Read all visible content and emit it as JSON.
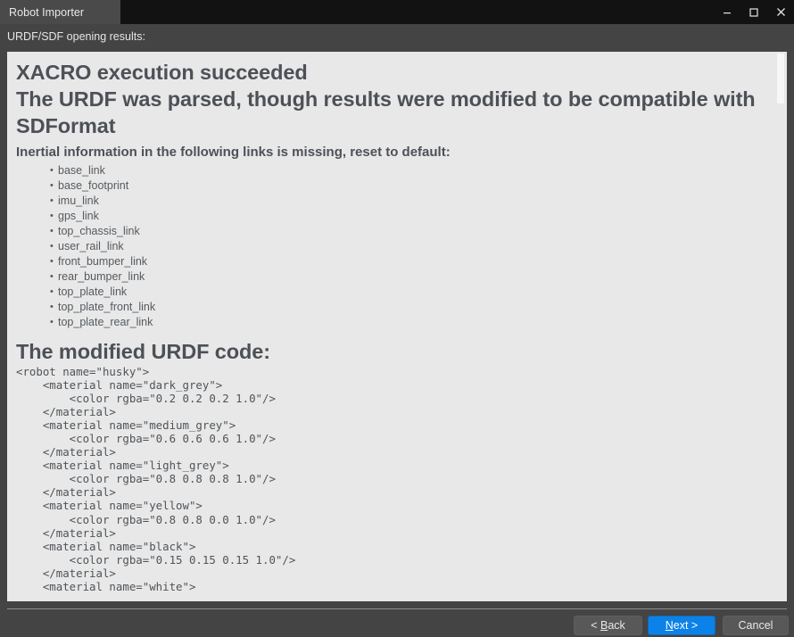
{
  "window": {
    "tab_title": "Robot Importer",
    "controls": {
      "minimize": "minimize-icon",
      "maximize": "maximize-icon",
      "close": "close-icon"
    }
  },
  "subtitle": "URDF/SDF opening results:",
  "results": {
    "heading_line_1": "XACRO execution succeeded",
    "heading_line_2": "The URDF was parsed, though results were modified to be compatible with SDFormat",
    "subheading": "Inertial information in the following links is missing, reset to default:",
    "missing_inertia_links": [
      "base_link",
      "base_footprint",
      "imu_link",
      "gps_link",
      "top_chassis_link",
      "user_rail_link",
      "front_bumper_link",
      "rear_bumper_link",
      "top_plate_link",
      "top_plate_front_link",
      "top_plate_rear_link"
    ],
    "code_heading": "The modified URDF code:",
    "code": "<robot name=\"husky\">\n    <material name=\"dark_grey\">\n        <color rgba=\"0.2 0.2 0.2 1.0\"/>\n    </material>\n    <material name=\"medium_grey\">\n        <color rgba=\"0.6 0.6 0.6 1.0\"/>\n    </material>\n    <material name=\"light_grey\">\n        <color rgba=\"0.8 0.8 0.8 1.0\"/>\n    </material>\n    <material name=\"yellow\">\n        <color rgba=\"0.8 0.8 0.0 1.0\"/>\n    </material>\n    <material name=\"black\">\n        <color rgba=\"0.15 0.15 0.15 1.0\"/>\n    </material>\n    <material name=\"white\">"
  },
  "footer": {
    "back_prefix": "< ",
    "back_accel": "B",
    "back_suffix": "ack",
    "next_accel": "N",
    "next_suffix": "ext >",
    "cancel_label": "Cancel"
  },
  "colors": {
    "titlebar_bg": "#121212",
    "tab_bg": "#4a4a4a",
    "window_bg": "#444444",
    "panel_bg": "#e8e8e8",
    "heading_text": "#4d5157",
    "body_text": "#555a5f",
    "code_text": "#4f5459",
    "accent_button": "#0c82e8",
    "button_bg": "#585858"
  }
}
